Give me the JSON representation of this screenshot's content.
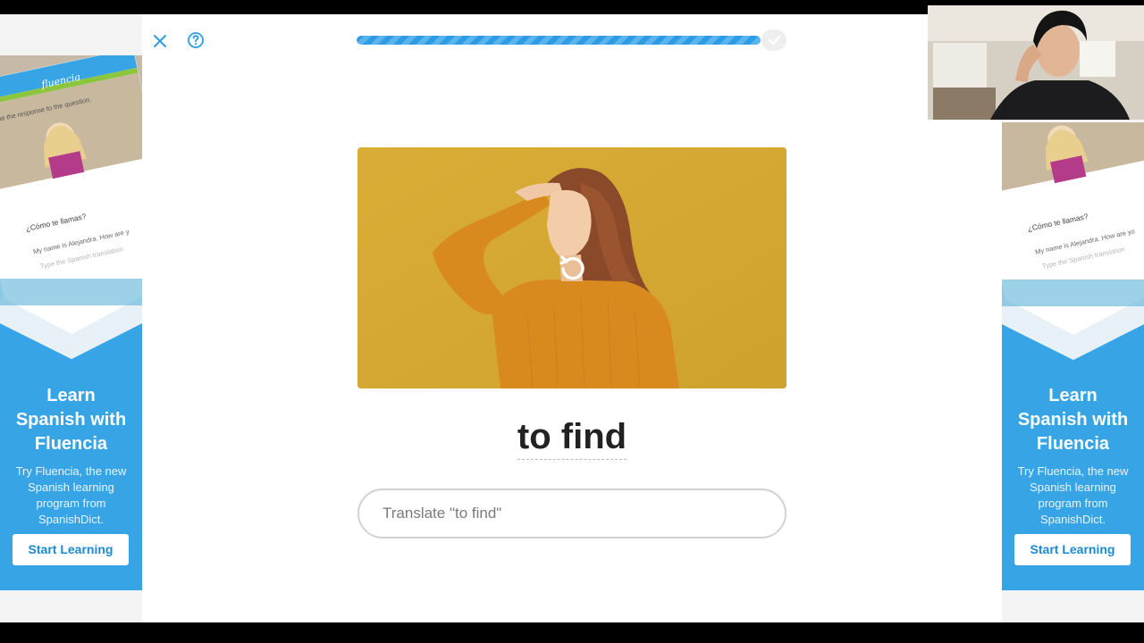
{
  "lesson": {
    "progress_percent": 100,
    "prompt_word": "to find",
    "answer": {
      "value": "",
      "placeholder": "Translate \"to find\""
    }
  },
  "icons": {
    "close": "close-icon",
    "help": "help-icon",
    "replay": "replay-icon",
    "complete": "check-icon"
  },
  "ad_left": {
    "banner_brand": "fluencia",
    "banner_instruction": "ate the response to the question.",
    "chat_question": "¿Cómo te llamas?",
    "chat_answer": "My name is Alejandra. How are y",
    "chat_input_placeholder": "Type the Spanish translation",
    "headline_lines": [
      "Learn",
      "Spanish with",
      "Fluencia"
    ],
    "body_lines": [
      "Try Fluencia, the new",
      "Spanish learning",
      "program from",
      "SpanishDict."
    ],
    "cta_label": "Start Learning"
  },
  "ad_right": {
    "chat_question": "¿Cómo te llamas?",
    "chat_answer": "My name is Alejandra. How are yo",
    "chat_input_placeholder": "Type the Spanish translation",
    "headline_lines": [
      "Learn",
      "Spanish with",
      "Fluencia"
    ],
    "body_lines": [
      "Try Fluencia, the new",
      "Spanish learning",
      "program from",
      "SpanishDict."
    ],
    "cta_label": "Start Learning"
  },
  "colors": {
    "accent": "#2f9be4",
    "ad_blue": "#37a4e6",
    "photo_background": "#d8ac34",
    "sweater": "#d98a1e"
  }
}
